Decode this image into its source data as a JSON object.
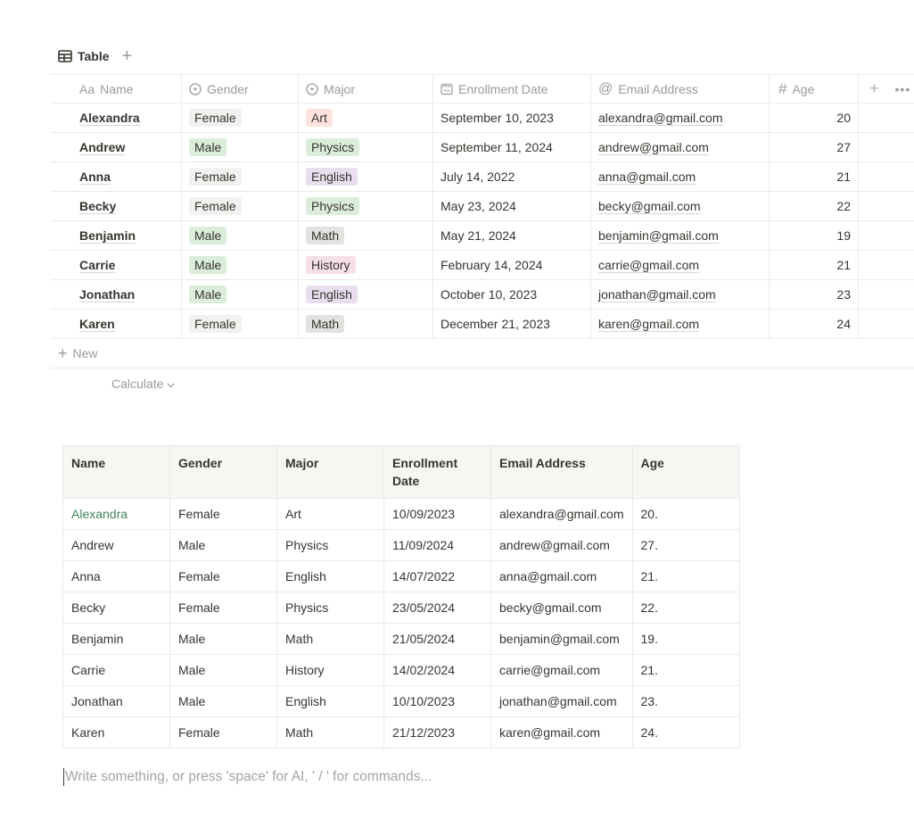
{
  "view_bar": {
    "active_tab": "Table",
    "tab_icon": "table-icon",
    "add_view_icon": "plus-icon"
  },
  "colors": {
    "tag_gray": "#f1f1ef",
    "tag_green": "#dbeddb",
    "tag_red": "#ffe2dd",
    "tag_purple": "#e8deee",
    "tag_pink": "#f5e0e9",
    "tag_darkgray": "#e3e2e0",
    "link_green": "#448361"
  },
  "database": {
    "columns": [
      {
        "label": "Name",
        "icon": "Aa"
      },
      {
        "label": "Gender",
        "icon": "select-icon"
      },
      {
        "label": "Major",
        "icon": "select-icon"
      },
      {
        "label": "Enrollment Date",
        "icon": "calendar-icon"
      },
      {
        "label": "Email Address",
        "icon": "@"
      },
      {
        "label": "Age",
        "icon": "#"
      }
    ],
    "rows": [
      {
        "name": "Alexandra",
        "gender": "Female",
        "gender_color": "#f1f1ef",
        "major": "Art",
        "major_color": "#ffe2dd",
        "date": "September 10, 2023",
        "email": "alexandra@gmail.com",
        "age": "20"
      },
      {
        "name": "Andrew",
        "gender": "Male",
        "gender_color": "#dbeddb",
        "major": "Physics",
        "major_color": "#dbeddb",
        "date": "September 11, 2024",
        "email": "andrew@gmail.com",
        "age": "27"
      },
      {
        "name": "Anna",
        "gender": "Female",
        "gender_color": "#f1f1ef",
        "major": "English",
        "major_color": "#e8deee",
        "date": "July 14, 2022",
        "email": "anna@gmail.com",
        "age": "21"
      },
      {
        "name": "Becky",
        "gender": "Female",
        "gender_color": "#f1f1ef",
        "major": "Physics",
        "major_color": "#dbeddb",
        "date": "May 23, 2024",
        "email": "becky@gmail.com",
        "age": "22"
      },
      {
        "name": "Benjamin",
        "gender": "Male",
        "gender_color": "#dbeddb",
        "major": "Math",
        "major_color": "#e3e2e0",
        "date": "May 21, 2024",
        "email": "benjamin@gmail.com",
        "age": "19"
      },
      {
        "name": "Carrie",
        "gender": "Male",
        "gender_color": "#dbeddb",
        "major": "History",
        "major_color": "#f5e0e9",
        "date": "February 14, 2024",
        "email": "carrie@gmail.com",
        "age": "21"
      },
      {
        "name": "Jonathan",
        "gender": "Male",
        "gender_color": "#dbeddb",
        "major": "English",
        "major_color": "#e8deee",
        "date": "October 10, 2023",
        "email": "jonathan@gmail.com",
        "age": "23"
      },
      {
        "name": "Karen",
        "gender": "Female",
        "gender_color": "#f1f1ef",
        "major": "Math",
        "major_color": "#e3e2e0",
        "date": "December 21, 2023",
        "email": "karen@gmail.com",
        "age": "24"
      }
    ],
    "new_label": "New",
    "calculate_label": "Calculate"
  },
  "simple_table": {
    "headers": [
      "Name",
      "Gender",
      "Major",
      "Enrollment Date",
      "Email Address",
      "Age"
    ],
    "rows": [
      [
        "Alexandra",
        "Female",
        "Art",
        "10/09/2023",
        "alexandra@gmail.com",
        "20."
      ],
      [
        "Andrew",
        "Male",
        "Physics",
        "11/09/2024",
        "andrew@gmail.com",
        "27."
      ],
      [
        "Anna",
        "Female",
        "English",
        "14/07/2022",
        "anna@gmail.com",
        "21."
      ],
      [
        "Becky",
        "Female",
        "Physics",
        "23/05/2024",
        "becky@gmail.com",
        "22."
      ],
      [
        "Benjamin",
        "Male",
        "Math",
        "21/05/2024",
        "benjamin@gmail.com",
        "19."
      ],
      [
        "Carrie",
        "Male",
        "History",
        "14/02/2024",
        "carrie@gmail.com",
        "21."
      ],
      [
        "Jonathan",
        "Male",
        "English",
        "10/10/2023",
        "jonathan@gmail.com",
        "23."
      ],
      [
        "Karen",
        "Female",
        "Math",
        "21/12/2023",
        "karen@gmail.com",
        "24."
      ]
    ]
  },
  "editor": {
    "placeholder": "Write something, or press 'space' for AI, ' / ' for commands..."
  }
}
